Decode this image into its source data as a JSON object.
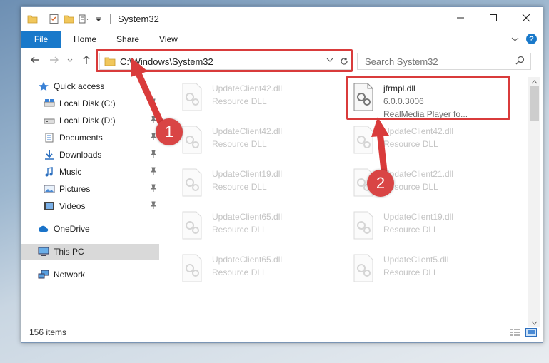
{
  "window": {
    "title": "System32"
  },
  "ribbon": {
    "file_tab": "File",
    "tabs": [
      "Home",
      "Share",
      "View"
    ],
    "help_label": "?"
  },
  "address": {
    "path": "C:\\Windows\\System32"
  },
  "search": {
    "placeholder": "Search System32"
  },
  "navpane": {
    "items": [
      {
        "label": "Quick access",
        "icon": "star-icon",
        "pinned": false
      },
      {
        "label": "Local Disk (C:)",
        "icon": "drive-icon",
        "pinned": true
      },
      {
        "label": "Local Disk (D:)",
        "icon": "drive-icon",
        "pinned": true
      },
      {
        "label": "Documents",
        "icon": "documents-icon",
        "pinned": true
      },
      {
        "label": "Downloads",
        "icon": "download-icon",
        "pinned": true
      },
      {
        "label": "Music",
        "icon": "music-icon",
        "pinned": true
      },
      {
        "label": "Pictures",
        "icon": "pictures-icon",
        "pinned": true
      },
      {
        "label": "Videos",
        "icon": "videos-icon",
        "pinned": true
      },
      {
        "label": "OneDrive",
        "icon": "cloud-icon",
        "pinned": false
      },
      {
        "label": "This PC",
        "icon": "computer-icon",
        "pinned": false,
        "selected": true
      },
      {
        "label": "Network",
        "icon": "network-icon",
        "pinned": false
      }
    ]
  },
  "files": [
    {
      "name": "UpdateClient42.dll",
      "type": "Resource DLL",
      "desc": ""
    },
    {
      "name": "jfrmpl.dll",
      "type": "6.0.0.3006",
      "desc": "RealMedia Player fo..."
    },
    {
      "name": "UpdateClient42.dll",
      "type": "Resource DLL",
      "desc": ""
    },
    {
      "name": "UpdateClient42.dll",
      "type": "Resource DLL",
      "desc": ""
    },
    {
      "name": "UpdateClient19.dll",
      "type": "Resource DLL",
      "desc": ""
    },
    {
      "name": "UpdateClient21.dll",
      "type": "Resource DLL",
      "desc": ""
    },
    {
      "name": "UpdateClient65.dll",
      "type": "Resource DLL",
      "desc": ""
    },
    {
      "name": "UpdateClient19.dll",
      "type": "Resource DLL",
      "desc": ""
    },
    {
      "name": "UpdateClient65.dll",
      "type": "Resource DLL",
      "desc": ""
    },
    {
      "name": "UpdateClient5.dll",
      "type": "Resource DLL",
      "desc": ""
    }
  ],
  "status": {
    "item_count": "156 items"
  },
  "annotations": {
    "step1": "1",
    "step2": "2",
    "color": "#d93b3b"
  }
}
